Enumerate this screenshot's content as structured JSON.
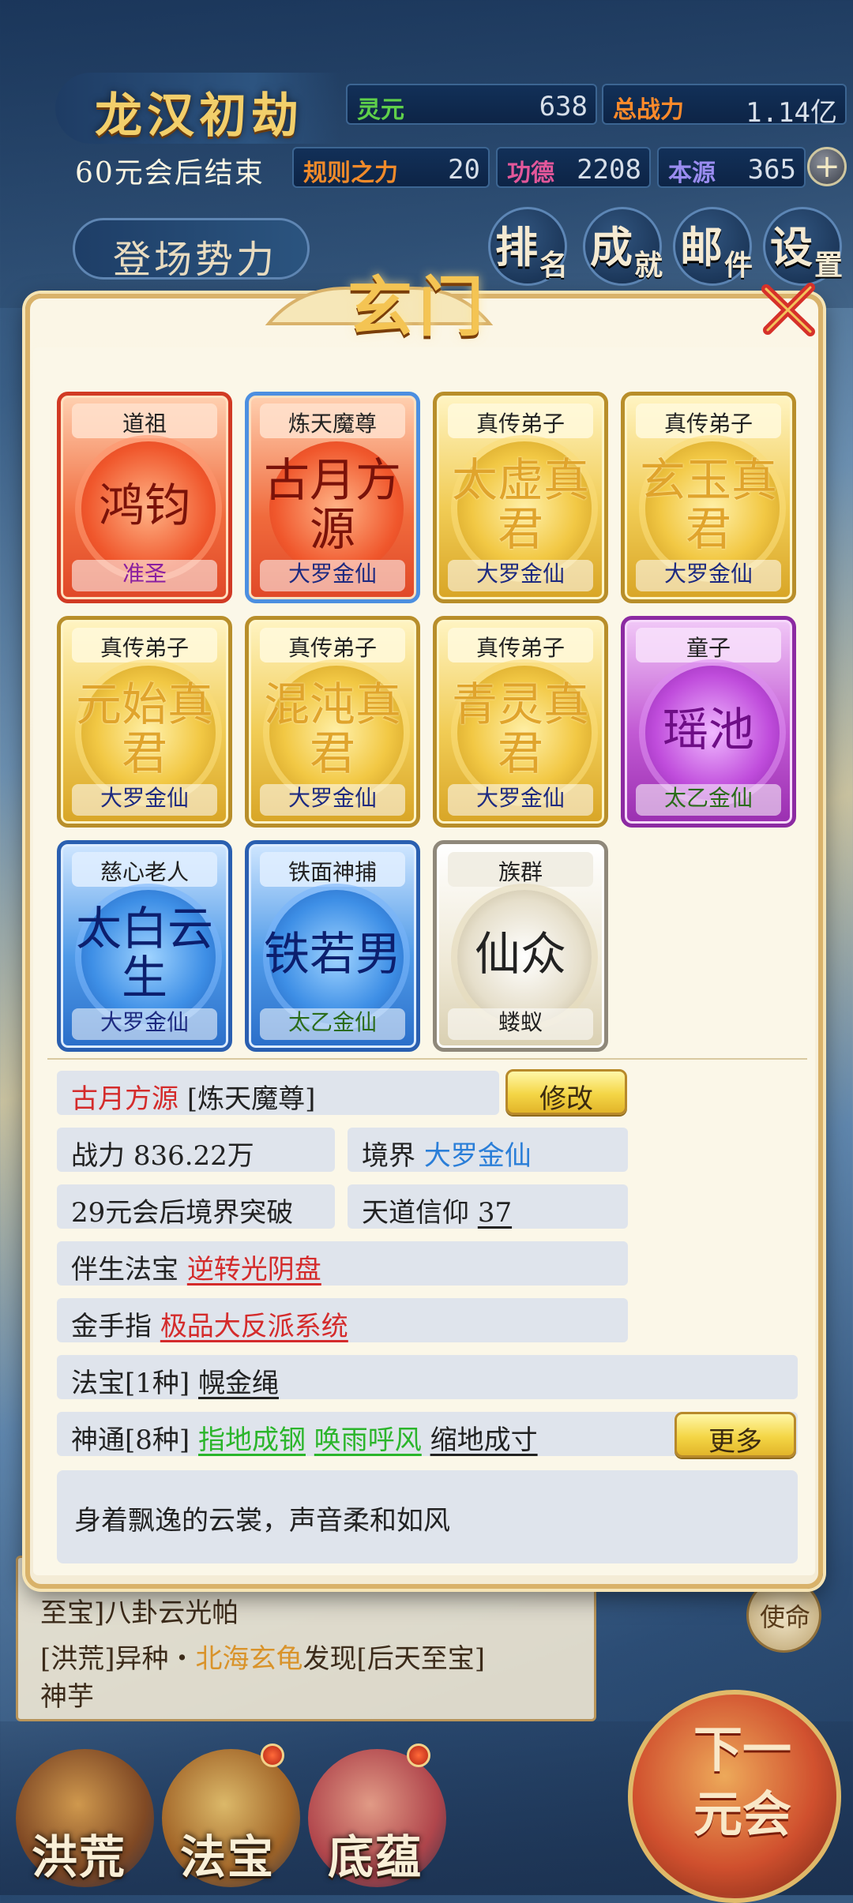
{
  "hud": {
    "era_title": "龙汉初劫",
    "countdown": "60元会后结束",
    "stats": {
      "lingyuan_label": "灵元",
      "lingyuan_value": "638",
      "power_label": "总战力",
      "power_value": "1.14亿",
      "rule_label": "规则之力",
      "rule_value": "20",
      "merit_label": "功德",
      "merit_value": "2208",
      "origin_label": "本源",
      "origin_value": "365"
    },
    "plus": "+",
    "faction_button": "登场势力",
    "menu": [
      {
        "big": "排",
        "small": "名"
      },
      {
        "big": "成",
        "small": "就"
      },
      {
        "big": "邮",
        "small": "件"
      },
      {
        "big": "设",
        "small": "置"
      }
    ]
  },
  "background": {
    "log_lines": [
      {
        "pre": "至宝]八卦云光帕",
        "gold": "",
        "post": ""
      },
      {
        "pre": "[洪荒]异种・",
        "gold": "北海玄龟",
        "post": "发现[后天至宝]"
      },
      {
        "pre": "神芋",
        "gold": "",
        "post": ""
      }
    ],
    "mission": "使命",
    "bottom_nav": [
      "洪荒",
      "法宝",
      "底蕴"
    ],
    "next_button": "下一元会"
  },
  "dialog": {
    "title": "玄门",
    "cards": [
      {
        "title": "道祖",
        "name": "鸿钧",
        "rank": "准圣",
        "style": "c-red"
      },
      {
        "title": "炼天魔尊",
        "name": "古月方源",
        "rank": "大罗金仙",
        "style": "c-redblue"
      },
      {
        "title": "真传弟子",
        "name": "太虚真君",
        "rank": "大罗金仙",
        "style": "c-gold"
      },
      {
        "title": "真传弟子",
        "name": "玄玉真君",
        "rank": "大罗金仙",
        "style": "c-gold"
      },
      {
        "title": "真传弟子",
        "name": "元始真君",
        "rank": "大罗金仙",
        "style": "c-gold"
      },
      {
        "title": "真传弟子",
        "name": "混沌真君",
        "rank": "大罗金仙",
        "style": "c-gold"
      },
      {
        "title": "真传弟子",
        "name": "青灵真君",
        "rank": "大罗金仙",
        "style": "c-gold"
      },
      {
        "title": "童子",
        "name": "瑶池",
        "rank": "太乙金仙",
        "style": "c-purple"
      },
      {
        "title": "慈心老人",
        "name": "太白云生",
        "rank": "大罗金仙",
        "style": "c-blue"
      },
      {
        "title": "铁面神捕",
        "name": "铁若男",
        "rank": "太乙金仙",
        "style": "c-blue"
      },
      {
        "title": "族群",
        "name": "仙众",
        "rank": "蝼蚁",
        "style": "c-white"
      }
    ],
    "detail": {
      "name": "古月方源",
      "title_tag": "[炼天魔尊]",
      "edit_button": "修改",
      "power_label": "战力",
      "power_value": "836.22万",
      "realm_label": "境界",
      "realm_value": "大罗金仙",
      "breakthrough": "29元会后境界突破",
      "faith_label": "天道信仰",
      "faith_value": "37",
      "companion_label": "伴生法宝",
      "companion_value": "逆转光阴盘",
      "finger_label": "金手指",
      "finger_value": "极品大反派系统",
      "treasure_label": "法宝[1种]",
      "treasure_value": "幌金绳",
      "skills_label": "神通[8种]",
      "skills": [
        "指地成钢",
        "唤雨呼风",
        "缩地成寸"
      ],
      "more_button": "更多",
      "description": "身着飘逸的云裳，声音柔和如风"
    }
  },
  "colors": {
    "red_text": "#d42b2b",
    "blue_text": "#2a7ed8",
    "green_text": "#2bb52b",
    "title_gold": "#f4c453"
  }
}
